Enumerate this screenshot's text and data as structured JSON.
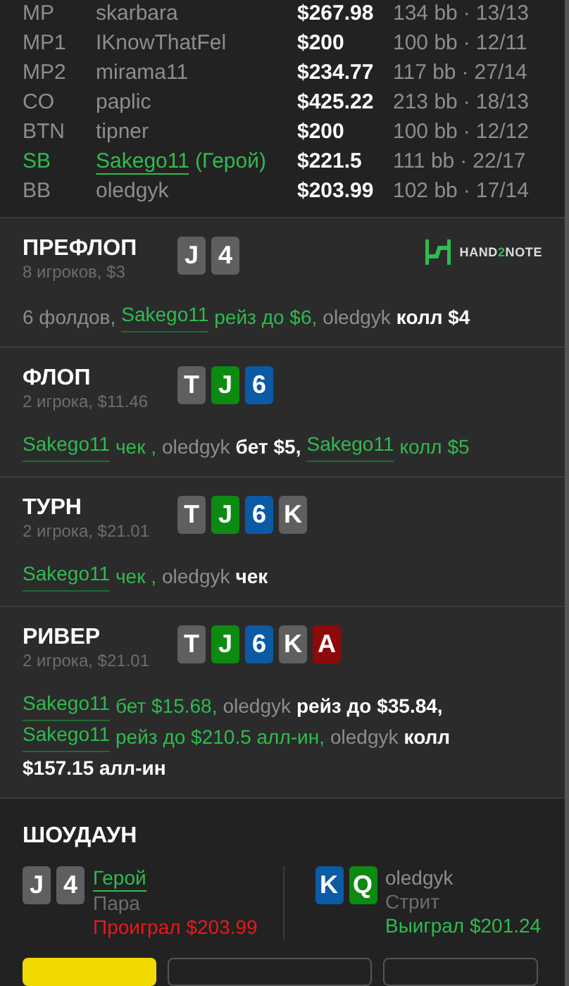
{
  "players": [
    {
      "position": "MP",
      "name": "skarbara",
      "stack": "$267.98",
      "bb": "134 bb",
      "sep": "·",
      "stats": "13/13",
      "hero": false
    },
    {
      "position": "MP1",
      "name": "IKnowThatFel",
      "stack": "$200",
      "bb": "100 bb",
      "sep": "·",
      "stats": "12/11",
      "hero": false
    },
    {
      "position": "MP2",
      "name": "mirama11",
      "stack": "$234.77",
      "bb": "117 bb",
      "sep": "·",
      "stats": "27/14",
      "hero": false
    },
    {
      "position": "CO",
      "name": "paplic",
      "stack": "$425.22",
      "bb": "213 bb",
      "sep": "·",
      "stats": "18/13",
      "hero": false
    },
    {
      "position": "BTN",
      "name": "tipner",
      "stack": "$200",
      "bb": "100 bb",
      "sep": "·",
      "stats": "12/12",
      "hero": false
    },
    {
      "position": "SB",
      "name": "Sakego11",
      "suffix": "(Герой)",
      "stack": "$221.5",
      "bb": "111 bb",
      "sep": "·",
      "stats": "22/17",
      "hero": true
    },
    {
      "position": "BB",
      "name": "oledgyk",
      "stack": "$203.99",
      "bb": "102 bb",
      "sep": "·",
      "stats": "17/14",
      "hero": false
    }
  ],
  "logo": {
    "text_a": "HAND",
    "text_b": "2",
    "text_c": "NOTE"
  },
  "streets": [
    {
      "title": "ПРЕФЛОП",
      "info": "8 игроков, $3",
      "cards": [
        {
          "rank": "J",
          "color": "#5f5f5f"
        },
        {
          "rank": "4",
          "color": "#5f5f5f"
        }
      ],
      "show_logo": true,
      "lines": [
        [
          {
            "kind": "plain",
            "text": "6 фолдов,"
          },
          {
            "kind": "hero_name",
            "text": "Sakego11"
          },
          {
            "kind": "hero_action",
            "text": "рейз до $6,"
          },
          {
            "kind": "name",
            "text": "oledgyk"
          },
          {
            "kind": "action",
            "text": "колл $4"
          }
        ]
      ]
    },
    {
      "title": "ФЛОП",
      "info": "2 игрока, $11.46",
      "cards": [
        {
          "rank": "T",
          "color": "#5f5f5f"
        },
        {
          "rank": "J",
          "color": "#0d8a12"
        },
        {
          "rank": "6",
          "color": "#0b5aa6"
        }
      ],
      "show_logo": false,
      "lines": [
        [
          {
            "kind": "hero_name",
            "text": "Sakego11"
          },
          {
            "kind": "hero_action",
            "text": "чек ,"
          },
          {
            "kind": "name",
            "text": "oledgyk"
          },
          {
            "kind": "action",
            "text": "бет $5,"
          },
          {
            "kind": "hero_name",
            "text": "Sakego11"
          },
          {
            "kind": "hero_action",
            "text": "колл $5"
          }
        ]
      ]
    },
    {
      "title": "ТУРН",
      "info": "2 игрока, $21.01",
      "cards": [
        {
          "rank": "T",
          "color": "#5f5f5f"
        },
        {
          "rank": "J",
          "color": "#0d8a12"
        },
        {
          "rank": "6",
          "color": "#0b5aa6"
        },
        {
          "rank": "K",
          "color": "#5f5f5f"
        }
      ],
      "show_logo": false,
      "lines": [
        [
          {
            "kind": "hero_name",
            "text": "Sakego11"
          },
          {
            "kind": "hero_action",
            "text": "чек ,"
          },
          {
            "kind": "name",
            "text": "oledgyk"
          },
          {
            "kind": "action",
            "text": "чек"
          }
        ]
      ]
    },
    {
      "title": "РИВЕР",
      "info": "2 игрока, $21.01",
      "cards": [
        {
          "rank": "T",
          "color": "#5f5f5f"
        },
        {
          "rank": "J",
          "color": "#0d8a12"
        },
        {
          "rank": "6",
          "color": "#0b5aa6"
        },
        {
          "rank": "K",
          "color": "#5f5f5f"
        },
        {
          "rank": "A",
          "color": "#8c0a0a"
        }
      ],
      "show_logo": false,
      "lines": [
        [
          {
            "kind": "hero_name",
            "text": "Sakego11"
          },
          {
            "kind": "hero_action",
            "text": "бет $15.68,"
          },
          {
            "kind": "name",
            "text": "oledgyk"
          },
          {
            "kind": "action",
            "text": "рейз до $35.84,"
          }
        ],
        [
          {
            "kind": "hero_name",
            "text": "Sakego11"
          },
          {
            "kind": "hero_action",
            "text": "рейз до $210.5 алл-ин,"
          },
          {
            "kind": "name",
            "text": "oledgyk"
          },
          {
            "kind": "action",
            "text": "колл"
          }
        ],
        [
          {
            "kind": "action",
            "text": "$157.15 алл-ин"
          }
        ]
      ]
    }
  ],
  "showdown": {
    "title": "ШОУДАУН",
    "hands": [
      {
        "cards": [
          {
            "rank": "J",
            "color": "#5f5f5f"
          },
          {
            "rank": "4",
            "color": "#5f5f5f"
          }
        ],
        "name": "Герой",
        "hero": true,
        "combo": "Пара",
        "result": "Проиграл $203.99",
        "won": false
      },
      {
        "cards": [
          {
            "rank": "K",
            "color": "#0b5aa6"
          },
          {
            "rank": "Q",
            "color": "#0d8a12"
          }
        ],
        "name": "oledgyk",
        "hero": false,
        "combo": "Стрит",
        "result": "Выиграл $201.24",
        "won": true
      }
    ]
  },
  "buttons": [
    {
      "kind": "primary"
    },
    {
      "kind": "outline"
    },
    {
      "kind": "outline"
    }
  ]
}
